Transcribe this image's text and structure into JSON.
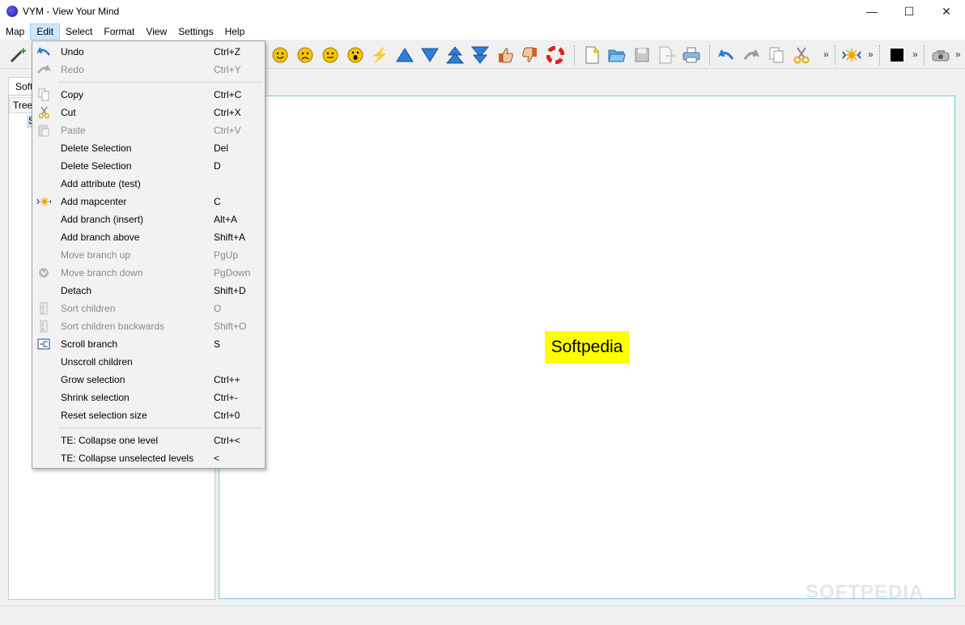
{
  "window": {
    "title": "VYM - View Your Mind",
    "minimize": "—",
    "maximize": "☐",
    "close": "✕"
  },
  "menubar": {
    "items": [
      "Map",
      "Edit",
      "Select",
      "Format",
      "View",
      "Settings",
      "Help"
    ],
    "active": "Edit"
  },
  "toolbar": {
    "overflow": "»"
  },
  "left_panel": {
    "tab_label": "Soft",
    "tree_header": "Tree",
    "tree_item": "S"
  },
  "canvas": {
    "mapcenter_text": "Softpedia",
    "mapcenter_color": "#ffff00",
    "border_color": "#7ccbd6"
  },
  "watermark": "SOFTPEDIA",
  "edit_menu": {
    "items": [
      {
        "label": "Undo",
        "shortcut": "Ctrl+Z",
        "enabled": true,
        "icon": "undo-icon"
      },
      {
        "label": "Redo",
        "shortcut": "Ctrl+Y",
        "enabled": false,
        "icon": "redo-icon"
      },
      {
        "label": "Copy",
        "shortcut": "Ctrl+C",
        "enabled": true,
        "icon": "copy-icon"
      },
      {
        "label": "Cut",
        "shortcut": "Ctrl+X",
        "enabled": true,
        "icon": "cut-icon"
      },
      {
        "label": "Paste",
        "shortcut": "Ctrl+V",
        "enabled": false,
        "icon": "paste-icon"
      },
      {
        "label": "Delete Selection",
        "shortcut": "Del",
        "enabled": true,
        "icon": ""
      },
      {
        "label": "Delete Selection",
        "shortcut": "D",
        "enabled": true,
        "icon": ""
      },
      {
        "label": "Add attribute (test)",
        "shortcut": "",
        "enabled": true,
        "icon": ""
      },
      {
        "label": "Add mapcenter",
        "shortcut": "C",
        "enabled": true,
        "icon": "mapcenter-icon"
      },
      {
        "label": "Add branch (insert)",
        "shortcut": "Alt+A",
        "enabled": true,
        "icon": ""
      },
      {
        "label": "Add branch above",
        "shortcut": "Shift+A",
        "enabled": true,
        "icon": ""
      },
      {
        "label": "Move branch up",
        "shortcut": "PgUp",
        "enabled": false,
        "icon": ""
      },
      {
        "label": "Move branch down",
        "shortcut": "PgDown",
        "enabled": false,
        "icon": "move-down-icon"
      },
      {
        "label": "Detach",
        "shortcut": "Shift+D",
        "enabled": true,
        "icon": ""
      },
      {
        "label": "Sort children",
        "shortcut": "O",
        "enabled": false,
        "icon": "sort-icon"
      },
      {
        "label": "Sort children backwards",
        "shortcut": "Shift+O",
        "enabled": false,
        "icon": "sort-backwards-icon"
      },
      {
        "label": "Scroll branch",
        "shortcut": "S",
        "enabled": true,
        "icon": "scroll-icon"
      },
      {
        "label": "Unscroll children",
        "shortcut": "",
        "enabled": true,
        "icon": ""
      },
      {
        "label": "Grow selection",
        "shortcut": "Ctrl++",
        "enabled": true,
        "icon": ""
      },
      {
        "label": "Shrink selection",
        "shortcut": "Ctrl+-",
        "enabled": true,
        "icon": ""
      },
      {
        "label": "Reset selection size",
        "shortcut": "Ctrl+0",
        "enabled": true,
        "icon": ""
      },
      {
        "label": "TE: Collapse one level",
        "shortcut": "Ctrl+<",
        "enabled": true,
        "icon": ""
      },
      {
        "label": "TE: Collapse unselected levels",
        "shortcut": "<",
        "enabled": true,
        "icon": ""
      }
    ]
  }
}
